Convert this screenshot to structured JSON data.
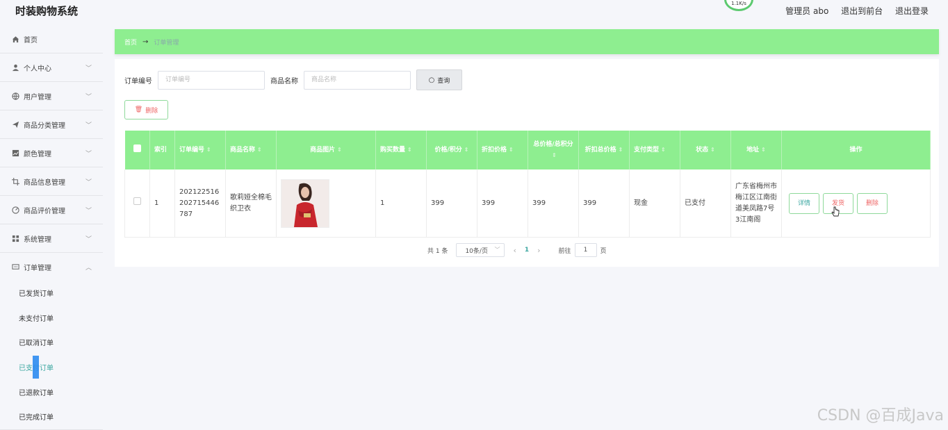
{
  "app": {
    "title": "时装购物系统"
  },
  "net_badge": "1.1K/s",
  "top_links": {
    "admin": "管理员 abo",
    "to_front": "退出到前台",
    "logout": "退出登录"
  },
  "sidebar": {
    "items": [
      {
        "label": "首页",
        "icon": "home-icon",
        "arrow": false
      },
      {
        "label": "个人中心",
        "icon": "user-icon",
        "arrow": true
      },
      {
        "label": "用户管理",
        "icon": "globe-icon",
        "arrow": true
      },
      {
        "label": "商品分类管理",
        "icon": "paper-plane-icon",
        "arrow": true
      },
      {
        "label": "颜色管理",
        "icon": "chart-icon",
        "arrow": true
      },
      {
        "label": "商品信息管理",
        "icon": "crop-icon",
        "arrow": true
      },
      {
        "label": "商品评价管理",
        "icon": "gauge-icon",
        "arrow": true
      },
      {
        "label": "系统管理",
        "icon": "grid-icon",
        "arrow": true
      },
      {
        "label": "订单管理",
        "icon": "chat-icon",
        "arrow": true,
        "expanded": true
      }
    ],
    "sub_items": [
      "已发货订单",
      "未支付订单",
      "已取消订单",
      "已支付订单",
      "已退款订单",
      "已完成订单"
    ],
    "active_sub": "已支付订单"
  },
  "breadcrumb": {
    "home": "首页",
    "sep": "→",
    "current": "订单管理"
  },
  "search": {
    "order_label": "订单编号",
    "order_placeholder": "订单编号",
    "product_label": "商品名称",
    "product_placeholder": "商品名称",
    "button": "查询"
  },
  "toolbar": {
    "delete": "删除"
  },
  "table": {
    "headers": [
      "索引",
      "订单编号",
      "商品名称",
      "商品图片",
      "购买数量",
      "价格/积分",
      "折扣价格",
      "总价格/总积分",
      "折扣总价格",
      "支付类型",
      "状态",
      "地址",
      "操作"
    ],
    "rows": [
      {
        "index": "1",
        "order_no": "202122516202715446787",
        "product": "歌莉娅全棉毛织卫衣",
        "qty": "1",
        "price": "399",
        "discount_price": "399",
        "total": "399",
        "discount_total": "399",
        "pay_type": "现金",
        "status": "已支付",
        "address": "广东省梅州市梅江区江南街道美凤路7号3江南阁",
        "actions": {
          "detail": "详情",
          "ship": "发货",
          "delete": "删除"
        }
      }
    ]
  },
  "pagination": {
    "total": "共 1 条",
    "page_size": "10条/页",
    "current": "1",
    "goto_label": "前往",
    "goto_value": "1",
    "page_suffix": "页"
  },
  "watermark": "CSDN @百成Java",
  "colors": {
    "accent": "#8eee90",
    "teal": "#3aa6a0",
    "danger": "#e66666"
  }
}
